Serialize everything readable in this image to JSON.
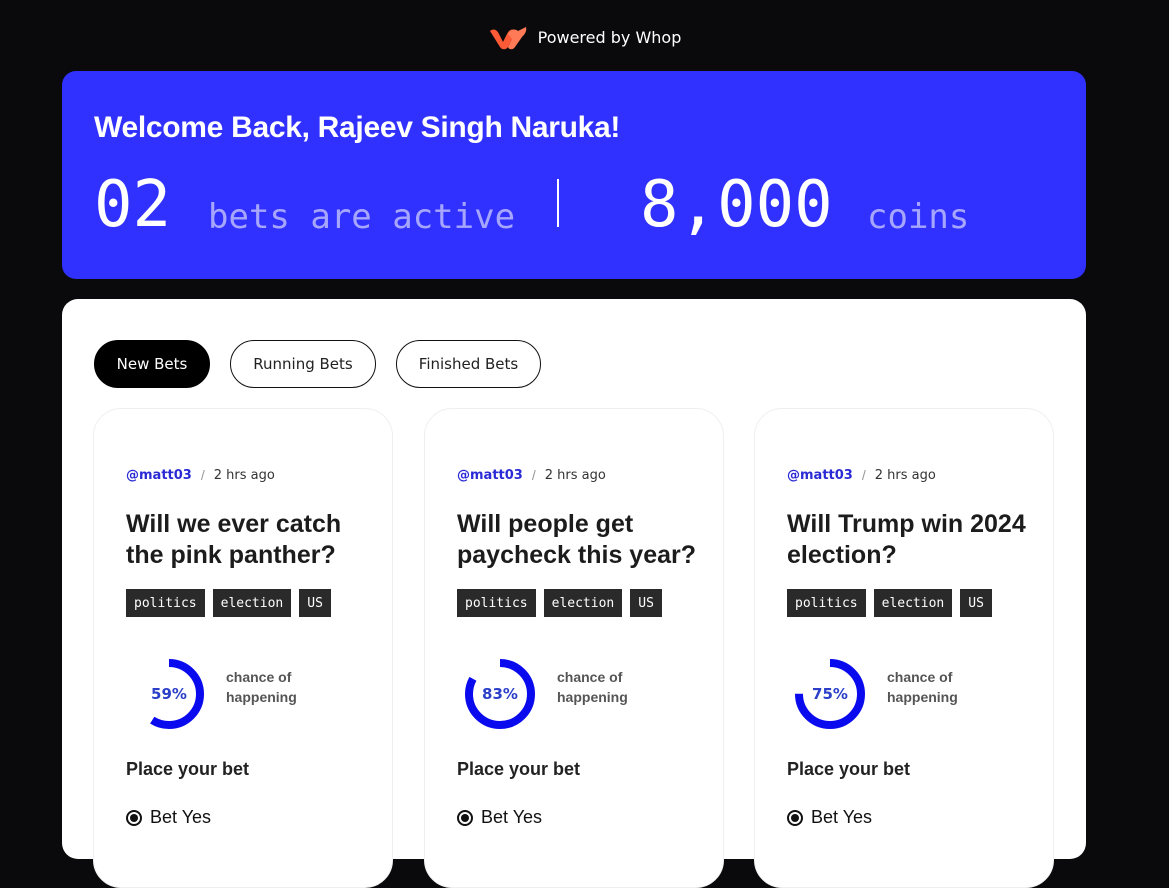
{
  "header": {
    "brand_text": "Powered by Whop",
    "logo_icon": "whop-logo-icon",
    "logo_color": "#ff5a36"
  },
  "hero": {
    "greeting": "Welcome Back, Rajeev Singh Naruka!",
    "active_bets_count": "02",
    "active_bets_label": "bets are active",
    "coins_count": "8,000",
    "coins_label": "coins",
    "background_color": "#3131ff"
  },
  "tabs": [
    {
      "label": "New Bets",
      "active": true
    },
    {
      "label": "Running Bets",
      "active": false
    },
    {
      "label": "Finished Bets",
      "active": false
    }
  ],
  "cards": [
    {
      "author": "@matt03",
      "separator": "/",
      "time_ago": "2 hrs ago",
      "question": "Will we ever catch the pink panther?",
      "tags": [
        "politics",
        "election",
        "US"
      ],
      "chance_percent": 59,
      "chance_text": "59%",
      "chance_label": "chance of happening",
      "place_bet_label": "Place your bet",
      "option_label": "Bet Yes",
      "option_selected": true
    },
    {
      "author": "@matt03",
      "separator": "/",
      "time_ago": "2 hrs ago",
      "question": "Will people get paycheck this year?",
      "tags": [
        "politics",
        "election",
        "US"
      ],
      "chance_percent": 83,
      "chance_text": "83%",
      "chance_label": "chance of happening",
      "place_bet_label": "Place your bet",
      "option_label": "Bet Yes",
      "option_selected": true
    },
    {
      "author": "@matt03",
      "separator": "/",
      "time_ago": "2 hrs ago",
      "question": "Will Trump win 2024 election?",
      "tags": [
        "politics",
        "election",
        "US"
      ],
      "chance_percent": 75,
      "chance_text": "75%",
      "chance_label": "chance of happening",
      "place_bet_label": "Place your bet",
      "option_label": "Bet Yes",
      "option_selected": true
    }
  ],
  "gauge_color": "#0a0aee"
}
